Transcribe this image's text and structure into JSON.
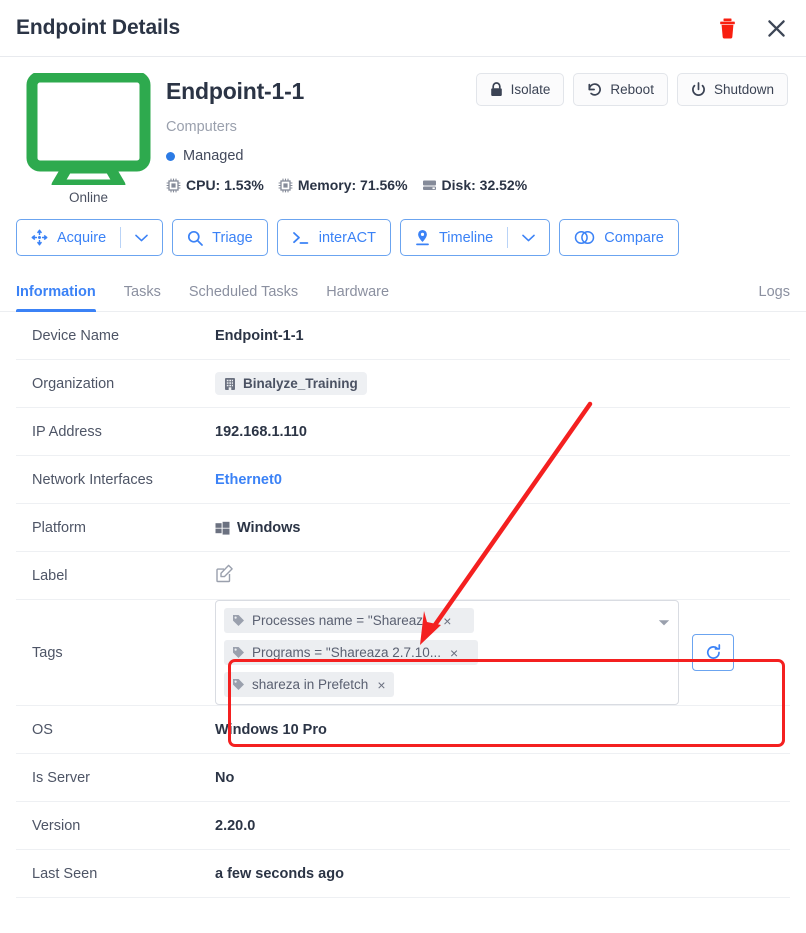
{
  "header": {
    "title": "Endpoint Details",
    "delete_icon": "trash-icon",
    "close_icon": "close-icon"
  },
  "summary": {
    "device_icon": "desktop-monitor-icon",
    "connection_state": "Online",
    "device_name": "Endpoint-1-1",
    "group": "Computers",
    "managed_status": "Managed",
    "managed_dot_color": "#2c7be5",
    "metrics": [
      {
        "icon": "cpu-chip-icon",
        "label": "CPU: 1.53%"
      },
      {
        "icon": "memory-chip-icon",
        "label": "Memory: 71.56%"
      },
      {
        "icon": "disk-drive-icon",
        "label": "Disk: 32.52%"
      }
    ],
    "power_actions": [
      {
        "icon": "lock-icon",
        "label": "Isolate"
      },
      {
        "icon": "reboot-icon",
        "label": "Reboot"
      },
      {
        "icon": "power-icon",
        "label": "Shutdown"
      }
    ]
  },
  "action_bar": [
    {
      "icon": "acquire-arrows-icon",
      "label": "Acquire",
      "has_caret": true
    },
    {
      "icon": "search-icon",
      "label": "Triage",
      "has_caret": false
    },
    {
      "icon": "terminal-prompt-icon",
      "label": "interACT",
      "has_caret": false
    },
    {
      "icon": "map-pin-icon",
      "label": "Timeline",
      "has_caret": true
    },
    {
      "icon": "venn-compare-icon",
      "label": "Compare",
      "has_caret": false
    }
  ],
  "tabs": {
    "left": [
      {
        "label": "Information",
        "active": true
      },
      {
        "label": "Tasks",
        "active": false
      },
      {
        "label": "Scheduled Tasks",
        "active": false
      },
      {
        "label": "Hardware",
        "active": false
      }
    ],
    "right": {
      "label": "Logs",
      "active": false
    }
  },
  "details": {
    "device_name": {
      "label": "Device Name",
      "value": "Endpoint-1-1"
    },
    "organization": {
      "label": "Organization",
      "value": "Binalyze_Training",
      "icon": "building-icon"
    },
    "ip_address": {
      "label": "IP Address",
      "value": "192.168.1.110"
    },
    "network_interfaces": {
      "label": "Network Interfaces",
      "value": "Ethernet0"
    },
    "platform": {
      "label": "Platform",
      "value": "Windows",
      "icon": "windows-logo-icon"
    },
    "label_row": {
      "label": "Label",
      "value": "",
      "icon": "edit-pencil-icon"
    },
    "tags": {
      "label": "Tags",
      "chips": [
        {
          "icon": "tag-icon",
          "text": "Processes name = \"Shareaz...",
          "remove": "×"
        },
        {
          "icon": "tag-icon",
          "text": "Programs = \"Shareaza 2.7.10...",
          "remove": "×"
        },
        {
          "icon": "tag-icon",
          "text": "shareza in Prefetch",
          "remove": "×"
        }
      ],
      "dropdown_icon": "chevron-down-icon",
      "refresh_icon": "refresh-icon"
    },
    "os": {
      "label": "OS",
      "value": "Windows 10 Pro"
    },
    "is_server": {
      "label": "Is Server",
      "value": "No"
    },
    "version": {
      "label": "Version",
      "value": "2.20.0"
    },
    "last_seen": {
      "label": "Last Seen",
      "value": "a few seconds ago"
    }
  },
  "annotations": {
    "highlight_color": "#f42020",
    "arrow_color": "#f42020"
  }
}
